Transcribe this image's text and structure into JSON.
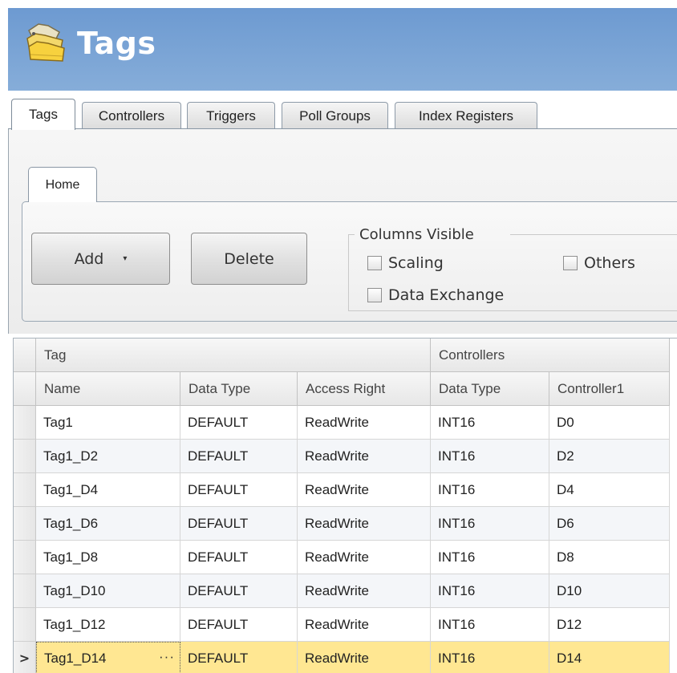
{
  "window": {
    "title": "Tags",
    "icon": "tags-folder-icon"
  },
  "tabs": [
    {
      "label": "Tags",
      "active": true
    },
    {
      "label": "Controllers",
      "active": false
    },
    {
      "label": "Triggers",
      "active": false
    },
    {
      "label": "Poll Groups",
      "active": false
    },
    {
      "label": "Index Registers",
      "active": false
    }
  ],
  "ribbon": {
    "tab_label": "Home",
    "add_label": "Add",
    "add_arrow": "▾",
    "delete_label": "Delete",
    "columns_visible": {
      "title": "Columns Visible",
      "scaling": {
        "label": "Scaling",
        "checked": false
      },
      "others": {
        "label": "Others",
        "checked": false
      },
      "data_exchange": {
        "label": "Data Exchange",
        "checked": false
      }
    }
  },
  "grid": {
    "group_headers": {
      "tag": "Tag",
      "controllers": "Controllers"
    },
    "columns": [
      "Name",
      "Data Type",
      "Access Right",
      "Data Type",
      "Controller1"
    ],
    "selected_indicator": ">",
    "ellipsis": "···",
    "rows": [
      [
        "Tag1",
        "DEFAULT",
        "ReadWrite",
        "INT16",
        "D0"
      ],
      [
        "Tag1_D2",
        "DEFAULT",
        "ReadWrite",
        "INT16",
        "D2"
      ],
      [
        "Tag1_D4",
        "DEFAULT",
        "ReadWrite",
        "INT16",
        "D4"
      ],
      [
        "Tag1_D6",
        "DEFAULT",
        "ReadWrite",
        "INT16",
        "D6"
      ],
      [
        "Tag1_D8",
        "DEFAULT",
        "ReadWrite",
        "INT16",
        "D8"
      ],
      [
        "Tag1_D10",
        "DEFAULT",
        "ReadWrite",
        "INT16",
        "D10"
      ],
      [
        "Tag1_D12",
        "DEFAULT",
        "ReadWrite",
        "INT16",
        "D12"
      ],
      [
        "Tag1_D14",
        "DEFAULT",
        "ReadWrite",
        "INT16",
        "D14"
      ]
    ],
    "selected_row": 7
  },
  "colors": {
    "title_bar": "#7aa3d5",
    "selected_row": "#ffe792",
    "alt_row": "#f4f6f9"
  }
}
